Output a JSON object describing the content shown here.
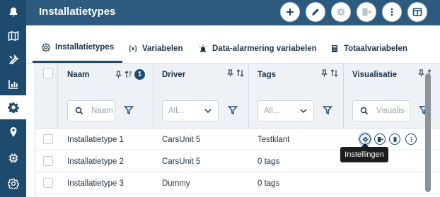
{
  "sidebar": {
    "items": [
      {
        "icon": "bell-icon",
        "active": false
      },
      {
        "icon": "map-icon",
        "active": false
      },
      {
        "icon": "tools-icon",
        "active": false
      },
      {
        "icon": "bar-chart-icon",
        "active": false
      },
      {
        "icon": "gear-icon",
        "active": true
      },
      {
        "icon": "location-pin-icon",
        "active": false
      },
      {
        "icon": "chip-icon",
        "active": false
      },
      {
        "icon": "gear-outline-icon",
        "active": false
      }
    ]
  },
  "header": {
    "title": "Installatietypes",
    "actions": [
      {
        "icon": "plus-icon",
        "enabled": true
      },
      {
        "icon": "pencil-icon",
        "enabled": true
      },
      {
        "icon": "settings-icon",
        "enabled": false
      },
      {
        "icon": "export-icon",
        "enabled": false
      },
      {
        "icon": "more-vertical-icon",
        "enabled": true
      },
      {
        "icon": "layout-icon",
        "enabled": true
      }
    ]
  },
  "tabs": [
    {
      "label": "Installatietypes",
      "icon": "gear-icon",
      "active": true
    },
    {
      "label": "Variabelen",
      "icon": "variable-icon",
      "active": false
    },
    {
      "label": "Data-alarmering variabelen",
      "icon": "siren-icon",
      "active": false
    },
    {
      "label": "Totaalvariabelen",
      "icon": "calculator-icon",
      "active": false
    }
  ],
  "table": {
    "columns": [
      {
        "label": "Naam",
        "filter_placeholder": "Naam",
        "sort_badge": "1"
      },
      {
        "label": "Driver",
        "filter_value": "All..."
      },
      {
        "label": "Tags",
        "filter_value": "All..."
      },
      {
        "label": "Visualisatie",
        "filter_placeholder": "Visualis"
      }
    ],
    "rows": [
      {
        "naam": "Installatietype 1",
        "driver": "CarsUnit 5",
        "tags": "Testklant",
        "has_actions": true
      },
      {
        "naam": "Installatietype 2",
        "driver": "CarsUnit 5",
        "tags": "0 tags",
        "has_actions": false
      },
      {
        "naam": "Installatietype 3",
        "driver": "Dummy",
        "tags": "0 tags",
        "has_actions": false
      }
    ]
  },
  "tooltip": {
    "text": "Instellingen"
  },
  "colors": {
    "nav": "#1e4a6d",
    "header": "#2d5a7f",
    "accent": "#1e4a6d",
    "table_header": "#eef2f6"
  }
}
